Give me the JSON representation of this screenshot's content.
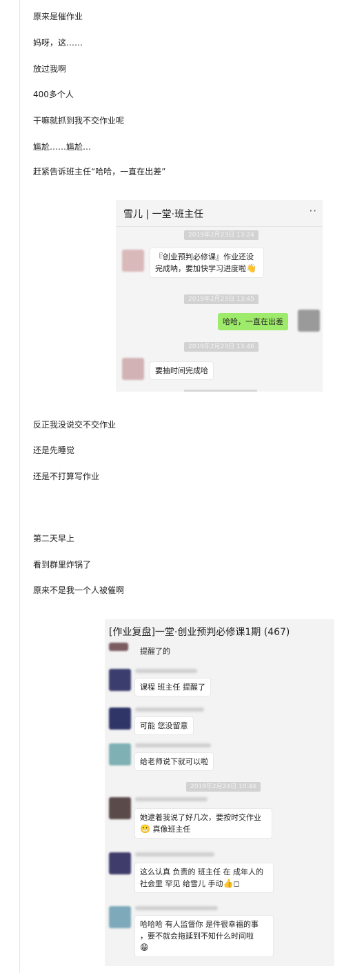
{
  "intro_lines": [
    "原来是催作业",
    "妈呀，这……",
    "放过我啊",
    "400多个人",
    "干嘛就抓到我不交作业呢",
    "尴尬……尴尬…",
    "赶紧告诉班主任“哈哈，一直在出差”"
  ],
  "chat1": {
    "title": "雪儿 | 一堂·班主任",
    "more_icon": "··",
    "timestamps": [
      "2019年2月23日 13:24",
      "2019年2月23日 13:45",
      "2019年2月23日 13:46"
    ],
    "messages": [
      "『创业预判必修课』作业还没完成呐，要加快学习进度啦",
      "哈哈，一直在出差",
      "要抽时间完成哈"
    ],
    "emoji_wave": "👋"
  },
  "middle_lines": [
    "反正我没说交不交作业",
    "还是先睡觉",
    "还是不打算写作业"
  ],
  "next_lines": [
    "第二天早上",
    "看到群里炸锅了",
    "原来不是我一个人被催啊"
  ],
  "chat2": {
    "title": "[作业复盘]一堂·创业预判必修课1期 (467)",
    "timestamp": "2019年2月24日 10:44",
    "messages": [
      "提醒了的",
      "课程 班主任 提醒了",
      "可能 您没留意",
      "给老师说下就可以啦",
      "她逮着我说了好几次，要按时交作业",
      "真像班主任",
      "这么认真 负责的 班主任 在 成年人的",
      "社会里 罕见 给雪儿 手动",
      "哈哈哈 有人监督你 是件很幸福的事",
      "，要不就会拖延到不知什么时间啦"
    ],
    "emoji_grin": "😬",
    "emoji_thumb": "👍",
    "emoji_box": "◻",
    "emoji_laugh": "😁"
  }
}
